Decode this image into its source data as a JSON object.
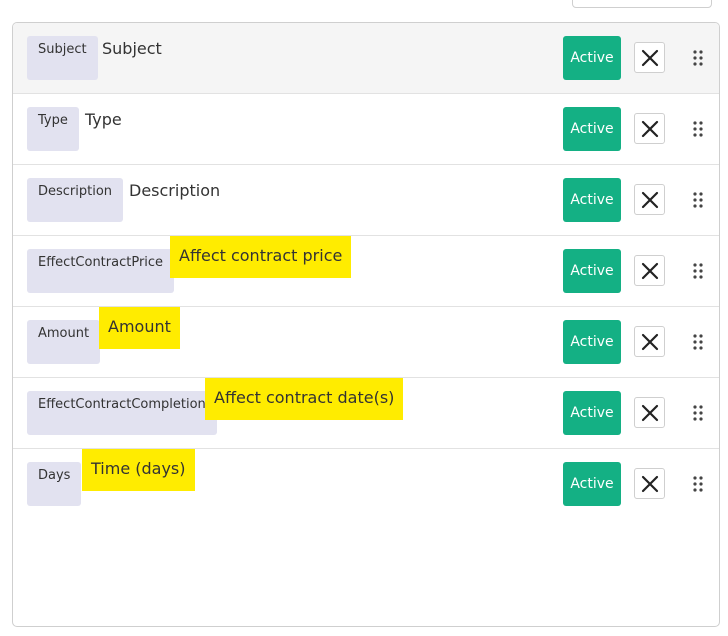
{
  "fields": [
    {
      "key": "Subject",
      "label": "Subject",
      "highlighted": false,
      "status": "Active"
    },
    {
      "key": "Type",
      "label": "Type",
      "highlighted": false,
      "status": "Active"
    },
    {
      "key": "Description",
      "label": "Description",
      "highlighted": false,
      "status": "Active"
    },
    {
      "key": "EffectContractPrice",
      "label": "Affect contract price",
      "highlighted": true,
      "status": "Active"
    },
    {
      "key": "Amount",
      "label": "Amount",
      "highlighted": true,
      "status": "Active"
    },
    {
      "key": "EffectContractCompletion",
      "label": "Affect contract date(s)",
      "highlighted": true,
      "status": "Active"
    },
    {
      "key": "Days",
      "label": "Time (days)",
      "highlighted": true,
      "status": "Active"
    }
  ],
  "icons": {
    "remove": "close-icon",
    "reorder": "drag-handle-icon"
  },
  "colors": {
    "active_button": "#14b084",
    "highlight": "#ffec00",
    "chip": "#e2e2f0",
    "first_row_bg": "#f5f5f5"
  }
}
